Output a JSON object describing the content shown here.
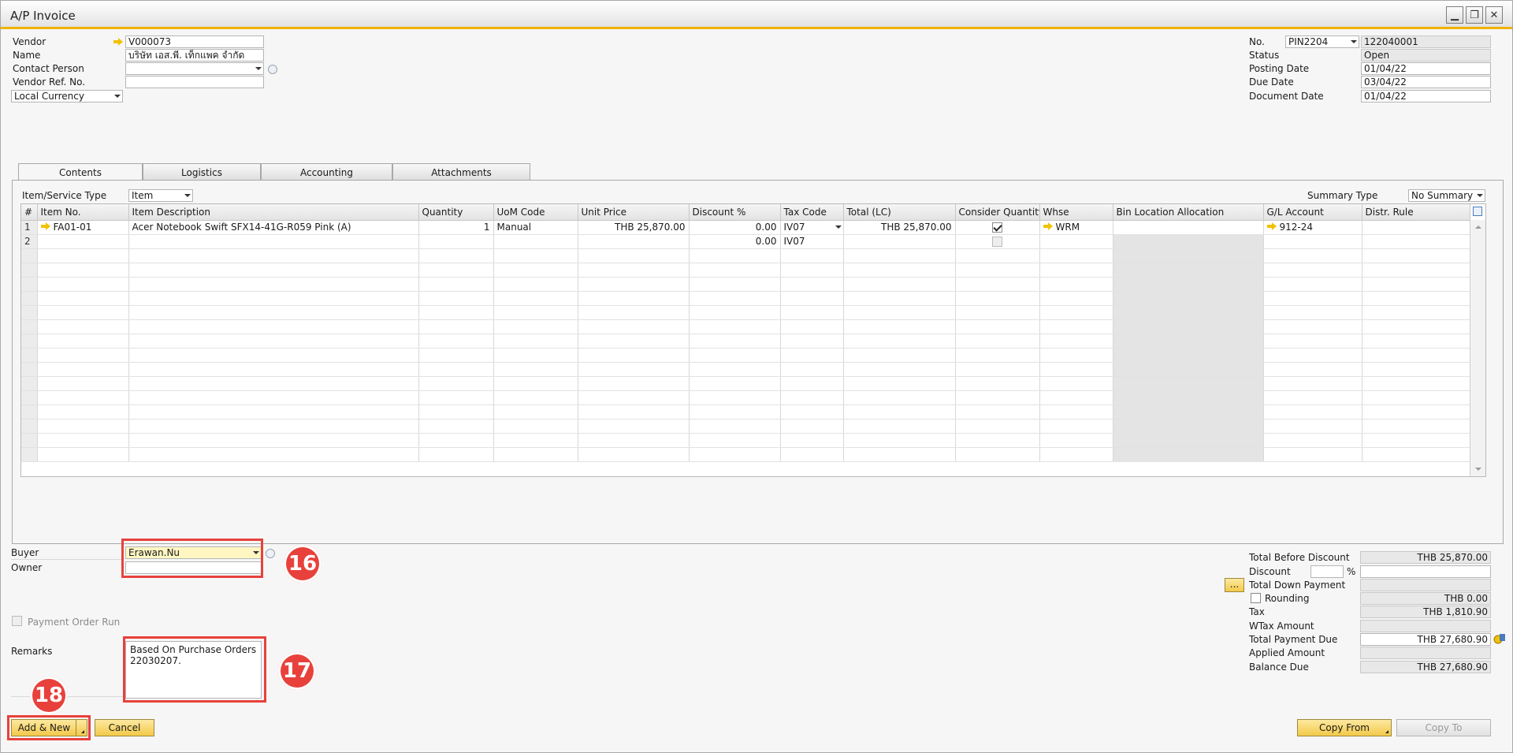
{
  "window": {
    "title": "A/P Invoice"
  },
  "header_left": {
    "vendor_label": "Vendor",
    "vendor_value": "V000073",
    "name_label": "Name",
    "name_value": "บริษัท เอส.พี. เท็กแพค จำกัด",
    "contact_label": "Contact Person",
    "contact_value": "",
    "vendor_ref_label": "Vendor Ref. No.",
    "vendor_ref_value": "",
    "currency_value": "Local Currency"
  },
  "header_right": {
    "no_label": "No.",
    "series_value": "PIN2204",
    "doc_number": "122040001",
    "status_label": "Status",
    "status_value": "Open",
    "posting_label": "Posting Date",
    "posting_value": "01/04/22",
    "due_label": "Due Date",
    "due_value": "03/04/22",
    "docdate_label": "Document Date",
    "docdate_value": "01/04/22"
  },
  "tabs": [
    {
      "label": "Contents"
    },
    {
      "label": "Logistics"
    },
    {
      "label": "Accounting"
    },
    {
      "label": "Attachments"
    }
  ],
  "contents": {
    "item_type_label": "Item/Service Type",
    "item_type_value": "Item",
    "summary_label": "Summary Type",
    "summary_value": "No Summary"
  },
  "grid": {
    "columns": [
      "#",
      "Item No.",
      "Item Description",
      "Quantity",
      "UoM Code",
      "Unit Price",
      "Discount %",
      "Tax Code",
      "Total (LC)",
      "Consider Quantity",
      "Whse",
      "Bin Location Allocation",
      "G/L Account",
      "Distr. Rule"
    ],
    "rows": [
      {
        "num": "1",
        "item_no": "FA01-01",
        "description": "Acer Notebook Swift SFX14-41G-R059 Pink (A)",
        "quantity": "1",
        "uom": "Manual",
        "unit_price": "THB 25,870.00",
        "discount": "0.00",
        "tax_code": "IV07",
        "total": "THB 25,870.00",
        "consider_qty": true,
        "whse": "WRM",
        "bin": "",
        "gl_account": "912-24",
        "distr_rule": ""
      },
      {
        "num": "2",
        "item_no": "",
        "description": "",
        "quantity": "",
        "uom": "",
        "unit_price": "",
        "discount": "0.00",
        "tax_code": "IV07",
        "total": "",
        "consider_qty": false,
        "whse": "",
        "bin": "",
        "gl_account": "",
        "distr_rule": ""
      }
    ]
  },
  "footer_left": {
    "buyer_label": "Buyer",
    "buyer_value": "Erawan.Nu",
    "owner_label": "Owner",
    "owner_value": "",
    "payment_order_label": "Payment Order Run",
    "remarks_label": "Remarks",
    "remarks_value": "Based On Purchase Orders\n22030207."
  },
  "totals": {
    "before_discount_label": "Total Before Discount",
    "before_discount_value": "THB 25,870.00",
    "discount_label": "Discount",
    "discount_pct": "",
    "pct_sign": "%",
    "discount_value": "",
    "down_payment_label": "Total Down Payment",
    "down_payment_value": "",
    "rounding_label": "Rounding",
    "rounding_value": "THB 0.00",
    "tax_label": "Tax",
    "tax_value": "THB 1,810.90",
    "wtax_label": "WTax Amount",
    "wtax_value": "",
    "payment_due_label": "Total Payment Due",
    "payment_due_value": "THB 27,680.90",
    "applied_label": "Applied Amount",
    "applied_value": "",
    "balance_label": "Balance Due",
    "balance_value": "THB 27,680.90",
    "dots_button": "..."
  },
  "buttons": {
    "add_new": "Add & New",
    "cancel": "Cancel",
    "copy_from": "Copy From",
    "copy_to": "Copy To"
  },
  "annotations": {
    "badge_16": "16",
    "badge_17": "17",
    "badge_18": "18"
  },
  "colors": {
    "accent": "#f0b400",
    "highlight": "#e8413c",
    "button": "#f3c94a"
  }
}
